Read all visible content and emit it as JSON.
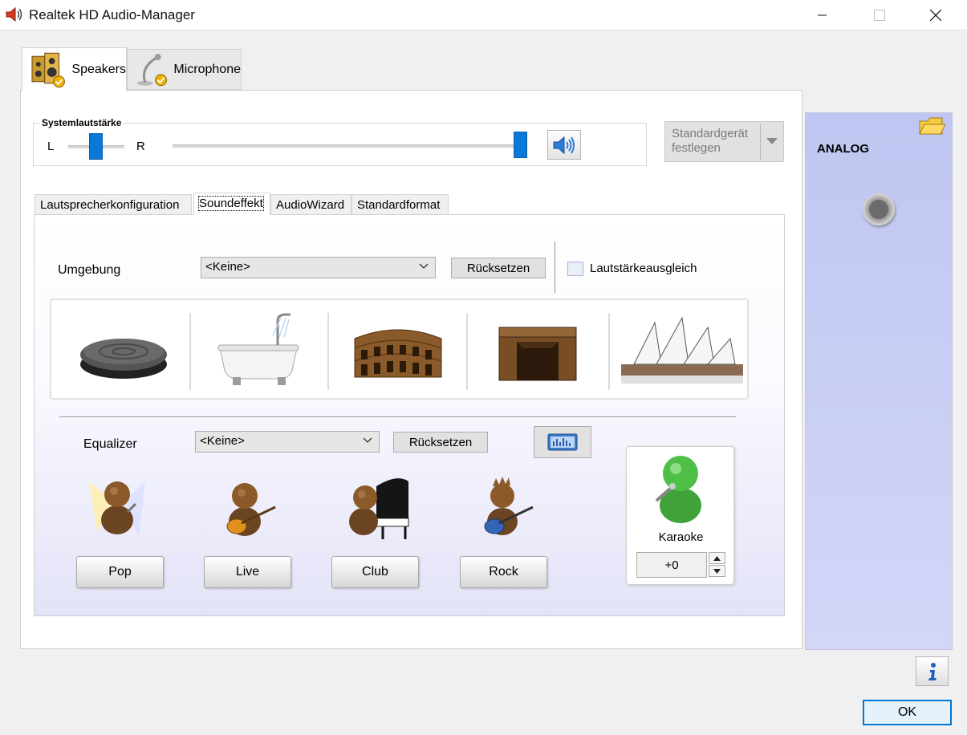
{
  "window": {
    "title": "Realtek HD Audio-Manager"
  },
  "device_tabs": [
    {
      "label": "Speakers",
      "icon": "speakers-icon",
      "active": true
    },
    {
      "label": "Microphone",
      "icon": "microphone-icon",
      "active": false
    }
  ],
  "system_volume": {
    "label": "Systemlautstärke",
    "left_label": "L",
    "right_label": "R",
    "balance_level": 0.5,
    "volume_level": 1.0
  },
  "standard_device_button": {
    "line1": "Standardgerät",
    "line2": "festlegen"
  },
  "inner_tabs": [
    {
      "label": "Lautsprecherkonfiguration",
      "active": false
    },
    {
      "label": "Soundeffekt",
      "active": true
    },
    {
      "label": "AudioWizard",
      "active": false
    },
    {
      "label": "Standardformat",
      "active": false
    }
  ],
  "environment": {
    "label": "Umgebung",
    "selected": "<Keine>",
    "reset_label": "Rücksetzen",
    "loudness_label": "Lautstärkeausgleich",
    "loudness_checked": false,
    "presets": [
      "stone-room-icon",
      "bathroom-icon",
      "colosseum-icon",
      "fireplace-icon",
      "opera-house-icon"
    ]
  },
  "equalizer": {
    "label": "Equalizer",
    "selected": "<Keine>",
    "reset_label": "Rücksetzen",
    "presets": [
      {
        "label": "Pop",
        "icon": "pop-singer-icon"
      },
      {
        "label": "Live",
        "icon": "live-guitarist-icon"
      },
      {
        "label": "Club",
        "icon": "club-pianist-icon"
      },
      {
        "label": "Rock",
        "icon": "rock-guitarist-icon"
      }
    ]
  },
  "karaoke": {
    "label": "Karaoke",
    "value": "+0"
  },
  "side_panel": {
    "label": "ANALOG"
  },
  "ok_label": "OK",
  "colors": {
    "accent": "#0078d7",
    "slider": "#0a78d7",
    "side_panel": "#c9cdf5"
  }
}
